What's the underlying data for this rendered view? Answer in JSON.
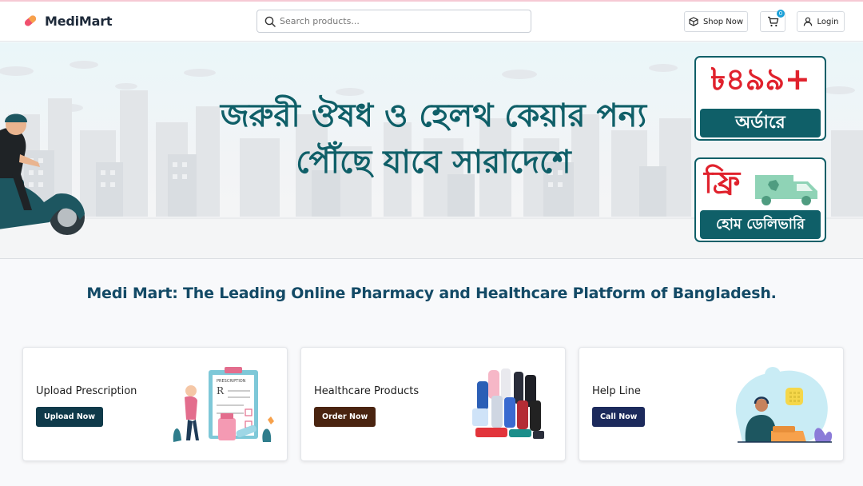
{
  "header": {
    "brand": "MediMart",
    "search_placeholder": "Search products...",
    "shop_label": "Shop Now",
    "cart_count": "0",
    "login_label": "Login"
  },
  "banner": {
    "headline_line1": "জরুরী ঔষধ ও হেলথ কেয়ার পন্য",
    "headline_line2": "পৌঁছে যাবে সারাদেশে",
    "offer_amount": "৳৪৯৯+",
    "offer_label": "অর্ডারে",
    "free_label": "ফ্রি",
    "delivery_label": "হোম ডেলিভারি"
  },
  "tagline": "Medi Mart: The Leading Online Pharmacy and Healthcare Platform of Bangladesh.",
  "cards": [
    {
      "title": "Upload Prescription",
      "button": "Upload Now"
    },
    {
      "title": "Healthcare Products",
      "button": "Order Now"
    },
    {
      "title": "Help Line",
      "button": "Call Now"
    }
  ],
  "colors": {
    "brand_teal": "#0f5f68",
    "offer_red": "#e0222d",
    "tagline_blue": "#134a66",
    "btn_upload": "#0f3a4a",
    "btn_order": "#4a2410",
    "btn_call": "#1c2a5c",
    "logo_pink": "#f0506e"
  },
  "icons": [
    "pill-logo-icon",
    "search-icon",
    "box-icon",
    "cart-icon",
    "user-icon"
  ]
}
